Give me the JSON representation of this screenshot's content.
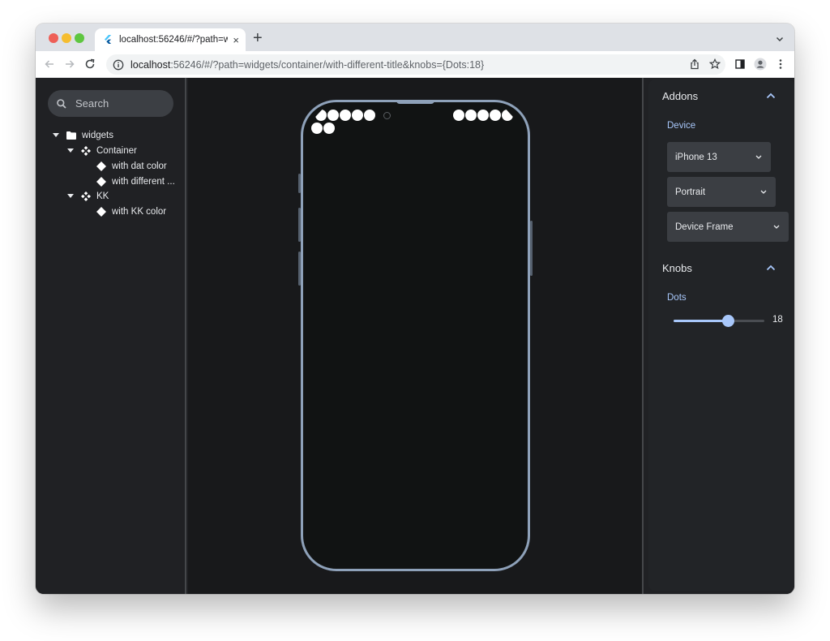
{
  "browser": {
    "tab": {
      "title": "localhost:56246/#/?path=widg",
      "close_label": "×"
    },
    "new_tab_label": "+",
    "url": {
      "host": "localhost",
      "rest": ":56246/#/?path=widgets/container/with-different-title&knobs={Dots:18}"
    }
  },
  "sidebar": {
    "search_placeholder": "Search",
    "tree": [
      {
        "label": "widgets",
        "icon": "folder-icon",
        "level": 0,
        "expanded": true
      },
      {
        "label": "Container",
        "icon": "component-icon",
        "level": 1,
        "expanded": true
      },
      {
        "label": "with dat color",
        "icon": "story-icon",
        "level": 2
      },
      {
        "label": "with different ...",
        "icon": "story-icon",
        "level": 2
      },
      {
        "label": "KK",
        "icon": "component-icon",
        "level": 1,
        "expanded": true
      },
      {
        "label": "with KK color",
        "icon": "story-icon",
        "level": 2
      }
    ]
  },
  "preview": {
    "dots_count": 18,
    "visible_dots": 12,
    "frame_color": "#8ea1b9"
  },
  "addons": {
    "title": "Addons",
    "device_label": "Device",
    "device_value": "iPhone 13",
    "orientation_value": "Portrait",
    "frame_value": "Device Frame"
  },
  "knobs": {
    "title": "Knobs",
    "dots_label": "Dots",
    "dots_value": "18",
    "dots_fraction": 0.6
  },
  "colors": {
    "accent": "#a8c7fa",
    "panel_bg": "#202124",
    "canvas_bg": "#18191b"
  }
}
